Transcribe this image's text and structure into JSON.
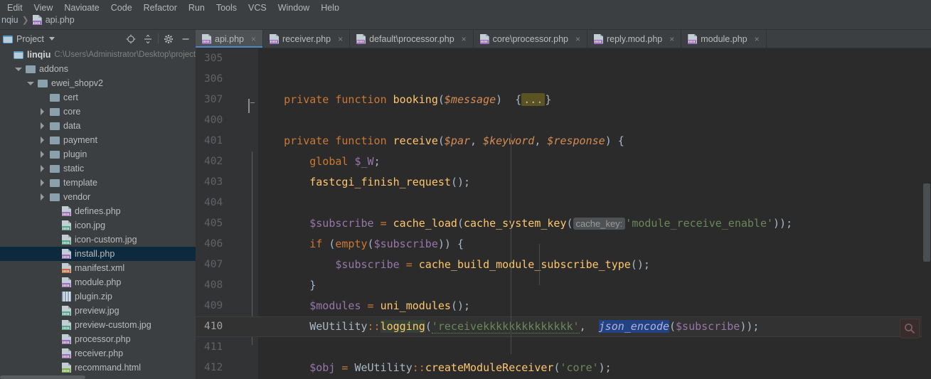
{
  "menubar": {
    "items": [
      "Edit",
      "View",
      "Navigate",
      "Code",
      "Refactor",
      "Run",
      "Tools",
      "VCS",
      "Window",
      "Help"
    ]
  },
  "breadcrumb": {
    "project": "nqiu",
    "separator": "❯",
    "file": "api.php",
    "file_icon": "php-file-icon"
  },
  "sidebar": {
    "title": "Project",
    "title_icon": "project-folder-icon",
    "caret_icon": "chevron-down-icon",
    "toolbar": [
      {
        "name": "locate-target-icon",
        "label": "⊕"
      },
      {
        "name": "collapse-all-icon",
        "label": "≡"
      },
      {
        "name": "gear-icon",
        "label": "⚙"
      },
      {
        "name": "hide-panel-icon",
        "label": "—"
      }
    ],
    "tree": [
      {
        "label": "linqiu",
        "path": "C:\\Users\\Administrator\\Desktop\\project",
        "indent": 0,
        "twisty": "none",
        "icon": "module-folder-icon",
        "root": true
      },
      {
        "label": "addons",
        "indent": 1,
        "twisty": "open",
        "icon": "folder-icon"
      },
      {
        "label": "ewei_shopv2",
        "indent": 2,
        "twisty": "open",
        "icon": "folder-icon"
      },
      {
        "label": "cert",
        "indent": 3,
        "twisty": "none",
        "icon": "folder-icon"
      },
      {
        "label": "core",
        "indent": 3,
        "twisty": "closed",
        "icon": "folder-icon"
      },
      {
        "label": "data",
        "indent": 3,
        "twisty": "closed",
        "icon": "folder-icon"
      },
      {
        "label": "payment",
        "indent": 3,
        "twisty": "closed",
        "icon": "folder-icon"
      },
      {
        "label": "plugin",
        "indent": 3,
        "twisty": "closed",
        "icon": "folder-icon"
      },
      {
        "label": "static",
        "indent": 3,
        "twisty": "closed",
        "icon": "folder-icon"
      },
      {
        "label": "template",
        "indent": 3,
        "twisty": "closed",
        "icon": "folder-icon"
      },
      {
        "label": "vendor",
        "indent": 3,
        "twisty": "closed",
        "icon": "folder-icon"
      },
      {
        "label": "defines.php",
        "indent": 4,
        "twisty": "none",
        "icon": "php-file-icon"
      },
      {
        "label": "icon.jpg",
        "indent": 4,
        "twisty": "none",
        "icon": "image-file-icon"
      },
      {
        "label": "icon-custom.jpg",
        "indent": 4,
        "twisty": "none",
        "icon": "image-file-icon"
      },
      {
        "label": "install.php",
        "indent": 4,
        "twisty": "none",
        "icon": "php-file-icon",
        "selected": true
      },
      {
        "label": "manifest.xml",
        "indent": 4,
        "twisty": "none",
        "icon": "xml-file-icon"
      },
      {
        "label": "module.php",
        "indent": 4,
        "twisty": "none",
        "icon": "php-file-icon"
      },
      {
        "label": "plugin.zip",
        "indent": 4,
        "twisty": "none",
        "icon": "zip-file-icon"
      },
      {
        "label": "preview.jpg",
        "indent": 4,
        "twisty": "none",
        "icon": "image-file-icon"
      },
      {
        "label": "preview-custom.jpg",
        "indent": 4,
        "twisty": "none",
        "icon": "image-file-icon"
      },
      {
        "label": "processor.php",
        "indent": 4,
        "twisty": "none",
        "icon": "php-file-icon"
      },
      {
        "label": "receiver.php",
        "indent": 4,
        "twisty": "none",
        "icon": "php-file-icon"
      },
      {
        "label": "recommand.html",
        "indent": 4,
        "twisty": "none",
        "icon": "html-file-icon"
      }
    ]
  },
  "editor": {
    "tabs": [
      {
        "label": "api.php",
        "icon": "php-file-icon",
        "active": true,
        "close_icon": "×"
      },
      {
        "label": "receiver.php",
        "icon": "php-file-icon",
        "active": false,
        "close_icon": "×"
      },
      {
        "label": "default\\processor.php",
        "icon": "php-file-icon",
        "active": false,
        "close_icon": "×"
      },
      {
        "label": "core\\processor.php",
        "icon": "php-file-icon",
        "active": false,
        "close_icon": "×"
      },
      {
        "label": "reply.mod.php",
        "icon": "php-file-icon",
        "active": false,
        "close_icon": "×"
      },
      {
        "label": "module.php",
        "icon": "php-file-icon",
        "active": false,
        "close_icon": "×"
      }
    ],
    "current_line": 410,
    "magnifier_icon": "search-magnifier-icon",
    "lines": [
      {
        "num": "305",
        "fold": "none",
        "indent_guides": []
      },
      {
        "num": "306",
        "fold": "none",
        "indent_guides": []
      },
      {
        "num": "307",
        "fold": "collapsed",
        "indent_guides": []
      },
      {
        "num": "400",
        "fold": "none",
        "indent_guides": []
      },
      {
        "num": "401",
        "fold": "region-start",
        "indent_guides": []
      },
      {
        "num": "402",
        "fold": "none",
        "indent_guides": [
          1
        ]
      },
      {
        "num": "403",
        "fold": "none",
        "indent_guides": [
          1
        ]
      },
      {
        "num": "404",
        "fold": "none",
        "indent_guides": [
          1
        ]
      },
      {
        "num": "405",
        "fold": "none",
        "indent_guides": [
          1
        ]
      },
      {
        "num": "406",
        "fold": "region-start",
        "indent_guides": [
          1
        ]
      },
      {
        "num": "407",
        "fold": "none",
        "indent_guides": [
          1,
          2
        ]
      },
      {
        "num": "408",
        "fold": "region-end",
        "indent_guides": [
          1
        ]
      },
      {
        "num": "409",
        "fold": "none",
        "indent_guides": [
          1
        ]
      },
      {
        "num": "410",
        "fold": "none",
        "indent_guides": [
          1
        ],
        "current": true
      },
      {
        "num": "411",
        "fold": "none",
        "indent_guides": [
          1
        ]
      },
      {
        "num": "412",
        "fold": "none",
        "indent_guides": [
          1
        ]
      }
    ],
    "code_text": [
      "",
      "",
      "    private function booking($message)  {...}",
      "",
      "    private function receive($par, $keyword, $response) {",
      "        global $_W;",
      "        fastcgi_finish_request();",
      "",
      "        $subscribe = cache_load(cache_system_key( cache_key: 'module_receive_enable'));",
      "        if (empty($subscribe)) {",
      "            $subscribe = cache_build_module_subscribe_type();",
      "        }",
      "        $modules = uni_modules();",
      "        WeUtility::logging('receivekkkkkkkkkkkkkk',  json_encode($subscribe));",
      "",
      "        $obj = WeUtility::createModuleReceiver('core');"
    ],
    "inline_hint": "cache_key:",
    "string_literals": [
      "'module_receive_enable'",
      "'receivekkkkkkkkkkkkkk'",
      "'core'"
    ]
  },
  "colors": {
    "editor_bg": "#2b2b2b",
    "gutter_bg": "#313335",
    "panel_bg": "#3c3f41",
    "active_tab_bg": "#4e5254",
    "active_tab_underline": "#4a88c7",
    "selection_blue": "#0d293e",
    "keyword": "#cc7832",
    "function_name": "#ffc66d",
    "string": "#6a8759",
    "variable": "#9876aa",
    "parameter": "#d58b54",
    "default_text": "#a9b7c6",
    "line_number": "#606366",
    "current_line_bg": "#323232"
  }
}
